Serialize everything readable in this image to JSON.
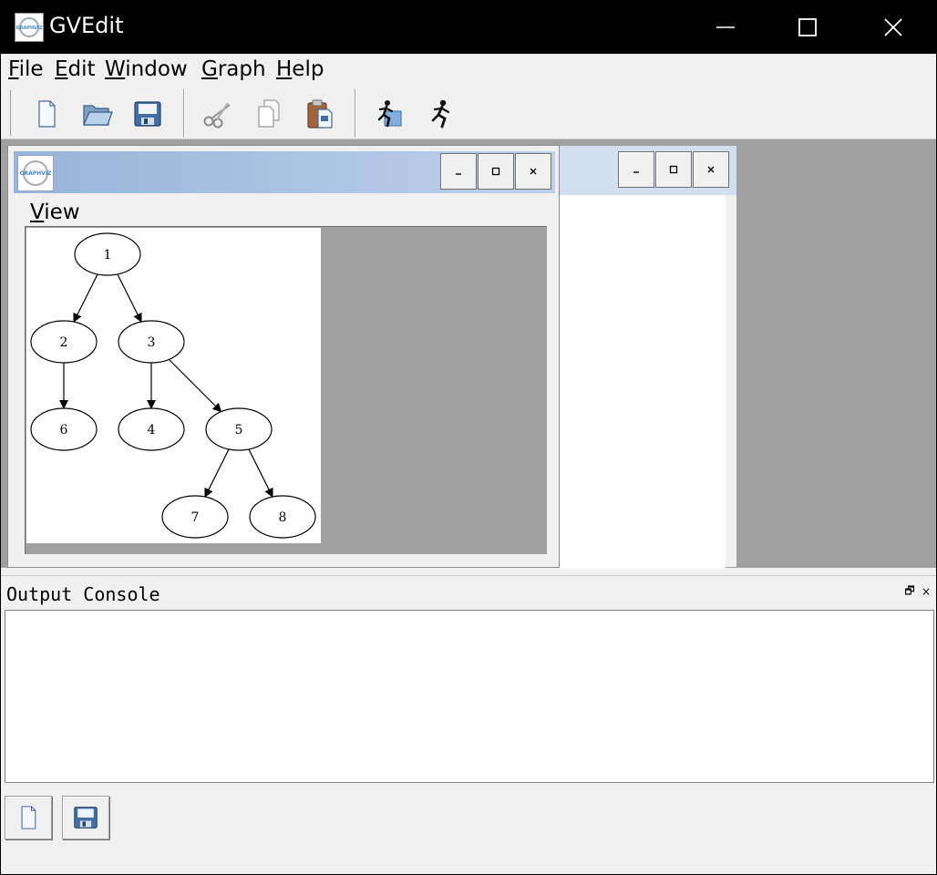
{
  "app": {
    "title": "GVEdit",
    "logo_text": "GRAPHVIZ"
  },
  "menu": {
    "items": [
      {
        "label": "File",
        "accel": "F",
        "rest": "ile"
      },
      {
        "label": "Edit",
        "accel": "E",
        "rest": "dit"
      },
      {
        "label": "Window",
        "accel": "W",
        "rest": "indow"
      },
      {
        "label": "Graph",
        "accel": "G",
        "rest": "raph"
      },
      {
        "label": "Help",
        "accel": "H",
        "rest": "elp"
      }
    ]
  },
  "toolbar": {
    "buttons": [
      "new-file-icon",
      "open-folder-icon",
      "save-disk-icon",
      "cut-scissors-icon",
      "copy-icon",
      "paste-icon",
      "layout-run-icon",
      "run-icon"
    ]
  },
  "subwindow": {
    "view_menu": {
      "accel": "V",
      "rest": "iew"
    },
    "logo_text": "GRAPHVIZ",
    "buttons": {
      "minimize": "_",
      "maximize": "□",
      "close": "×"
    }
  },
  "graph": {
    "nodes": [
      "1",
      "2",
      "3",
      "4",
      "5",
      "6",
      "7",
      "8"
    ],
    "edges": [
      [
        "1",
        "2"
      ],
      [
        "1",
        "3"
      ],
      [
        "2",
        "6"
      ],
      [
        "3",
        "4"
      ],
      [
        "3",
        "5"
      ],
      [
        "5",
        "7"
      ],
      [
        "5",
        "8"
      ]
    ]
  },
  "console": {
    "title": "Output Console",
    "float_icon": "🗗",
    "close_icon": "×"
  },
  "colors": {
    "titlebar": "#000000",
    "subwindow_title_start": "#98b4d8",
    "subwindow_title_end": "#bdd0ea",
    "mdi_background": "#a0a0a0"
  }
}
